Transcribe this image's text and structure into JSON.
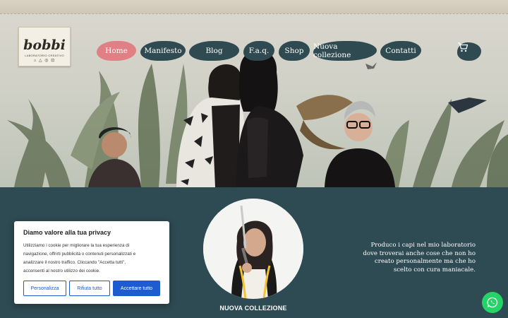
{
  "logo": {
    "name": "bobbi",
    "tagline": "LABORATORIO CREATIVO"
  },
  "nav": {
    "items": [
      {
        "label": "Home",
        "active": true
      },
      {
        "label": "Manifesto",
        "active": false
      },
      {
        "label": "Blog",
        "active": false
      },
      {
        "label": "F.a.q.",
        "active": false
      },
      {
        "label": "Shop",
        "active": false
      },
      {
        "label": "Nuova collezione",
        "active": false
      },
      {
        "label": "Contatti",
        "active": false
      }
    ],
    "cart_icon": "cart-icon"
  },
  "colors": {
    "nav_bg": "#2f4a51",
    "nav_active": "#e07f84",
    "section_bg": "#2e4a52",
    "cookie_accent": "#1d5bd1",
    "whatsapp": "#25d366"
  },
  "hero": {
    "image_icon": "hero-photo"
  },
  "collection": {
    "label": "NUOVA COLLEZIONE"
  },
  "tagline": {
    "line1": "Produco i capi nel mio laboratorio",
    "line2": "dove troverai anche cose che non ho",
    "line3": "creato personalmente ma che ho",
    "line4": "scelto con cura maniacale."
  },
  "cookie": {
    "title": "Diamo valore alla tua privacy",
    "line1": "Utilizziamo i cookie per migliorare la tua esperienza di",
    "line2": "navigazione, offrirti pubblicità o contenuti personalizzati e",
    "line3": "analizzare il nostro traffico. Cliccando \"Accetta tutti\",",
    "line4": "acconsenti al nostro utilizzo dei cookie.",
    "btn_customize": "Personalizza",
    "btn_reject": "Rifiuta tutto",
    "btn_accept": "Accettare tutto"
  },
  "whatsapp_icon": "whatsapp-icon"
}
